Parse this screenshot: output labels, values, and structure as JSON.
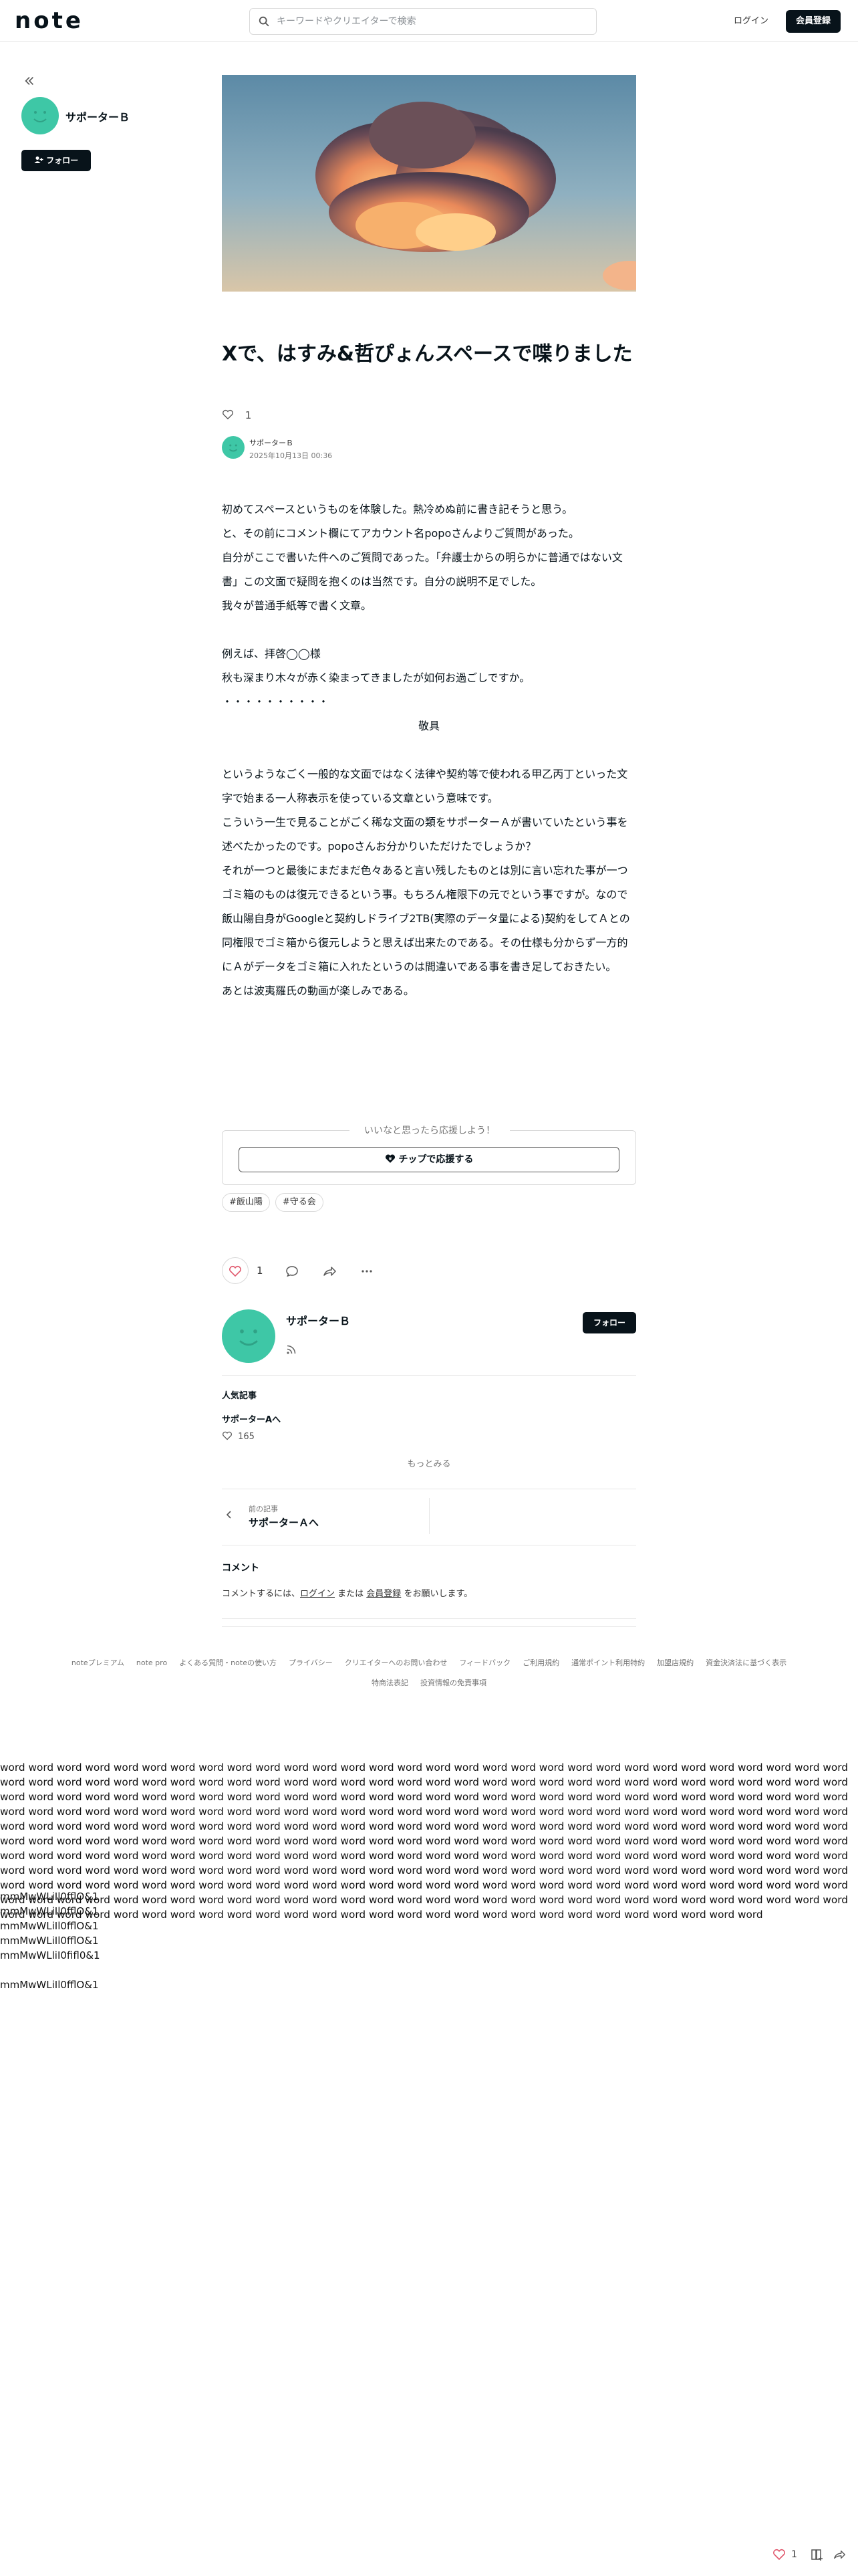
{
  "header": {
    "logo": "note",
    "search_placeholder": "キーワードやクリエイターで検索",
    "login": "ログイン",
    "signup": "会員登録"
  },
  "sidebar": {
    "author_name": "サポーターＢ",
    "follow": "フォロー"
  },
  "article": {
    "title": "Xで、はすみ&哲ぴょんスペースで喋りました",
    "likes": "1",
    "author": "サポーターＢ",
    "date": "2025年10月13日 00:36",
    "paragraphs": [
      "初めてスペースというものを体験した。熱冷めぬ前に書き記そうと思う。",
      "と、その前にコメント欄にてアカウント名popoさんよりご質問があった。",
      "自分がここで書いた件へのご質問であった。「弁護士からの明らかに普通ではない文書」この文面で疑問を抱くのは当然です。自分の説明不足でした。",
      "我々が普通手紙等で書く文章。",
      "",
      "例えば、拝啓◯◯様",
      "秋も深まり木々が赤く染まってきましたが如何お過ごしですか。",
      "・・・・・・・・・・",
      "敬具",
      "",
      "というようなごく一般的な文面ではなく法律や契約等で使われる甲乙丙丁といった文字で始まる一人称表示を使っている文章という意味です。",
      "こういう一生で見ることがごく稀な文面の類をサポーターＡが書いていたという事を述べたかったのです。popoさんお分かりいただけたでしょうか？",
      "それが一つと最後にまだまだ色々あると言い残したものとは別に言い忘れた事が一つゴミ箱のものは復元できるという事。もちろん権限下の元でという事ですが。なので飯山陽自身がGoogleと契約しドライブ2TB(実際のデータ量による)契約をしてＡとの同権限でゴミ箱から復元しようと思えば出来たのである。その仕様も分からず一方的にＡがデータをゴミ箱に入れたというのは間違いである事を書き足しておきたい。",
      "あとは波夷羅氏の動画が楽しみである。"
    ],
    "tip_label": "いいなと思ったら応援しよう！",
    "tip_button": "チップで応援する",
    "tags": [
      "#飯山陽",
      "#守る会"
    ],
    "action_likes": "1"
  },
  "creator": {
    "name": "サポーターＢ",
    "follow": "フォロー",
    "popular_heading": "人気記事",
    "popular_title": "サポーターAへ",
    "popular_likes": "165",
    "more": "もっとみる"
  },
  "prev": {
    "label": "前の記事",
    "title": "サポーターＡへ"
  },
  "comments": {
    "heading": "コメント",
    "prefix": "コメントするには、",
    "login": "ログイン",
    "middle": " または ",
    "signup": "会員登録",
    "suffix": " をお願いします。"
  },
  "footer": {
    "links": [
      "noteプレミアム",
      "note pro",
      "よくある質問・noteの使い方",
      "プライバシー",
      "クリエイターへのお問い合わせ",
      "フィードバック",
      "ご利用規約",
      "通常ポイント利用特約",
      "加盟店規約",
      "資金決済法に基づく表示",
      "特商法表記",
      "投資情報の免責事項"
    ]
  },
  "test_text": {
    "words": "word word word word word word word word word word word word word word word word word word word word word word word word word word word word word word word word word word word word word word word word word word word word word word word word word word word word word word word word word word word word word word word word word word word word word word word word word word word word word word word word word word word word word word word word word word word word word word word word word word word word word word word word word word word word word word word word word word word word word word word word word word word word word word word word word word word word word word word word word word word word word word word word word word word word word word word word word word word word word word word word word word word word word word word word word word word word word word word word word word word word word word word word word word word word word word word word word word word word word word word word word word word word word word word word word word word word word word word word word word word word word word word word word word word word word word word word word word word word word word word word word word word word word word word word word word word word word word word word word word word word word word word word word word word word word word word word word word word word word word word word word word word word word word word word word word word word word word word word word word word word word word word word word word word word word word word word word word word word word word word word word word word word word word word",
    "lines": [
      "mmMwWLiIl0fflO&1",
      "mmMwWLiIl0fflO&1",
      "mmMwWLiIl0fflO&1",
      "mmMwWLiIl0fflO&1",
      "mmMwWLliI0fifl0&1",
      "",
      "mmMwWLiIl0fflO&1"
    ]
  },
  "bottom_bar": {
    "likes": "1"
  },
  "colors": {
    "brand_dark": "#08131a",
    "avatar": "#3ec7a6",
    "like_red": "#e0566b"
  },
  "icons": [
    "chevrons-left-icon",
    "search-icon",
    "person-plus-icon",
    "heart-icon",
    "comment-icon",
    "share-icon",
    "more-icon",
    "rss-icon",
    "chevron-left-icon",
    "magazine-icon"
  ]
}
